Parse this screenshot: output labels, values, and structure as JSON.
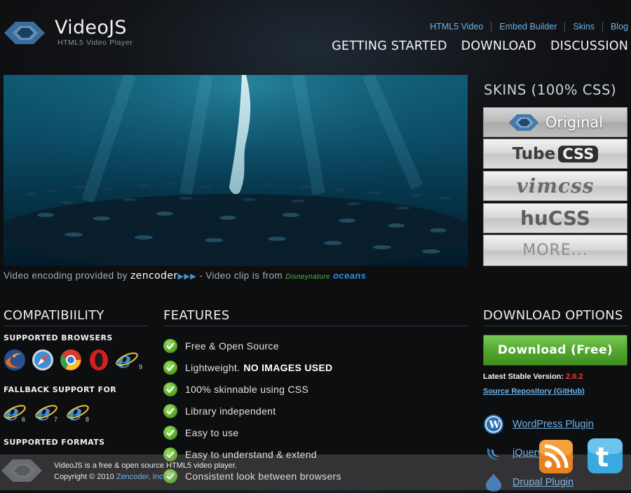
{
  "header": {
    "logo_name": "VideoJS",
    "logo_tagline": "HTML5 Video Player",
    "top_links": [
      "HTML5 Video",
      "Embed Builder",
      "Skins",
      "Blog"
    ],
    "main_nav": [
      "GETTING STARTED",
      "DOWNLOAD",
      "DISCUSSION"
    ]
  },
  "video_credit": {
    "prefix": "Video encoding provided by",
    "zencoder": "zencoder",
    "middle": "- Video clip is from",
    "disneynature": "Disneynature",
    "oceans": "oceans"
  },
  "skins": {
    "title": "SKINS (100% CSS)",
    "original": "Original",
    "tube_a": "Tube",
    "tube_b": "CSS",
    "vimcss": "vimcss",
    "hucss": "huCSS",
    "more": "MORE..."
  },
  "compatibility": {
    "title": "COMPATIBIILITY",
    "browsers_title": "SUPPORTED BROWSERS",
    "browsers": [
      "firefox-icon",
      "safari-icon",
      "chrome-icon",
      "opera-icon",
      "ie-icon"
    ],
    "browser_ie_version": "9",
    "fallback_title": "FALLBACK SUPPORT FOR",
    "fallback_versions": [
      "6",
      "7",
      "8"
    ],
    "formats_title": "SUPPORTED FORMATS"
  },
  "features": {
    "title": "FEATURES",
    "items": [
      {
        "text": "Free & Open Source",
        "strong": ""
      },
      {
        "text": "Lightweight.",
        "strong": "NO IMAGES USED"
      },
      {
        "text": "100% skinnable using CSS",
        "strong": ""
      },
      {
        "text": "Library independent",
        "strong": ""
      },
      {
        "text": "Easy to use",
        "strong": ""
      },
      {
        "text": "Easy to understand & extend",
        "strong": ""
      },
      {
        "text": "Consistent look between browsers",
        "strong": ""
      }
    ]
  },
  "download": {
    "title": "DOWNLOAD OPTIONS",
    "button": "Download (Free)",
    "version_label": "Latest Stable Version:",
    "version": "2.0.2",
    "repo": "Source Repository (GitHub)",
    "plugins": [
      "WordPress Plugin",
      "jQuery Plugin",
      "Drupal Plugin"
    ]
  },
  "footer": {
    "line1": "VideoJS is a free & open source HTML5 video player.",
    "line2_prefix": "Copyright © 2010",
    "line2_link": "Zencoder, Inc."
  },
  "colors": {
    "accent_link": "#6fb2e6",
    "download_green": "#54a830",
    "version_red": "#ff3b30"
  }
}
